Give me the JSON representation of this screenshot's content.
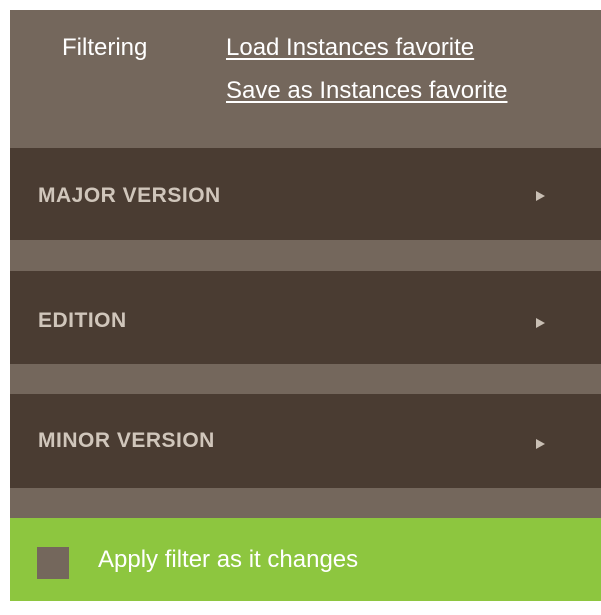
{
  "header": {
    "title": "Filtering",
    "load_favorite_link": "Load Instances favorite",
    "save_favorite_link": "Save as Instances favorite"
  },
  "sections": [
    {
      "label": "MAJOR VERSION",
      "expand_icon": "triangle-right-icon"
    },
    {
      "label": "EDITION",
      "expand_icon": "triangle-right-icon"
    },
    {
      "label": "MINOR VERSION",
      "expand_icon": "triangle-right-icon"
    }
  ],
  "apply": {
    "checkbox_checked": false,
    "label": "Apply filter as it changes"
  },
  "colors": {
    "header_bg": "#74675c",
    "section_bg": "#4a3c32",
    "section_text": "#d0c6bb",
    "apply_bg": "#8dc63f",
    "checkbox_bg": "#74675c"
  }
}
